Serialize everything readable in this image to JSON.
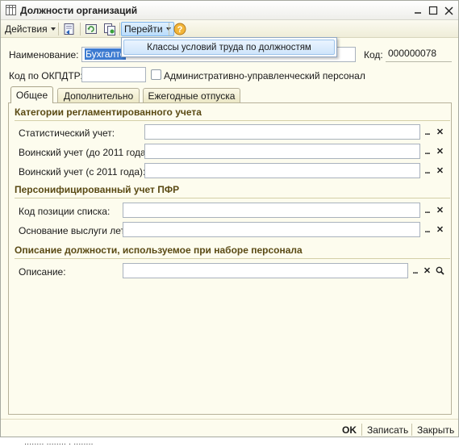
{
  "window": {
    "title": "Должности организаций"
  },
  "toolbar": {
    "actions_label": "Действия",
    "goto_label": "Перейти"
  },
  "goto_menu": {
    "items": [
      "Классы условий труда по должностям"
    ]
  },
  "form": {
    "name_label": "Наименование:",
    "name_value": "Бухгалте",
    "code_label": "Код:",
    "code_value": "000000078",
    "okpdtr_label": "Код по ОКПДТР:",
    "okpdtr_value": "",
    "admin_checkbox_label": "Административно-управленческий персонал",
    "admin_checked": false
  },
  "tabs": [
    "Общее",
    "Дополнительно",
    "Ежегодные отпуска"
  ],
  "sections": {
    "regulated": {
      "title": "Категории регламентированного учета",
      "fields": [
        "Статистический учет:",
        "Воинский учет (до 2011 года):",
        "Воинский учет (с 2011 года):"
      ]
    },
    "pfr": {
      "title": "Персонифицированный учет ПФР",
      "fields": [
        "Код позиции списка:",
        "Основание выслуги лет:"
      ]
    },
    "description": {
      "title": "Описание должности, используемое при наборе персонала",
      "field_label": "Описание:"
    }
  },
  "buttons": {
    "select": "...",
    "clear": "✕"
  },
  "footer": {
    "ok": "OK",
    "save": "Записать",
    "close": "Закрыть"
  },
  "behind_text": "........ ........ . ........"
}
